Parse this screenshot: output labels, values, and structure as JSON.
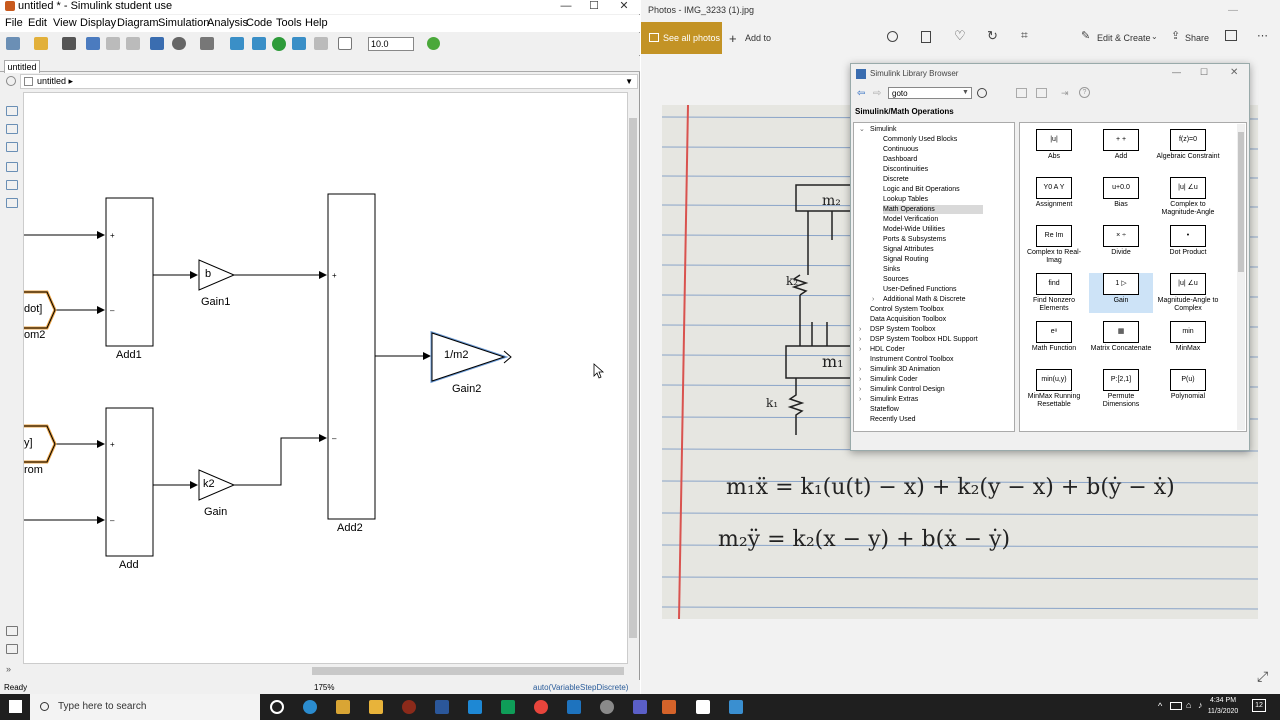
{
  "simulink": {
    "title": "untitled * - Simulink student use",
    "menu": [
      "File",
      "Edit",
      "View",
      "Display",
      "Diagram",
      "Simulation",
      "Analysis",
      "Code",
      "Tools",
      "Help"
    ],
    "sim_time": "10.0",
    "tab": "untitled",
    "address": "untitled",
    "status_left": "Ready",
    "status_zoom": "175%",
    "status_solver": "auto(VariableStepDiscrete)",
    "blocks": {
      "add1_label": "Add1",
      "add2_label": "Add2",
      "add_label": "Add",
      "gain1_value": "b",
      "gain1_label": "Gain1",
      "gain_value": "k2",
      "gain_label": "Gain",
      "gain2_value": "1/m2",
      "gain2_label": "Gain2",
      "from_upper_text": "dot]",
      "from_upper_label": "om2",
      "from_lower_text": "y]",
      "from_lower_label": "rom"
    }
  },
  "photos": {
    "title": "Photos - IMG_3233 (1).jpg",
    "see_all": "See all photos",
    "add_to": "Add to",
    "edit_create": "Edit & Create",
    "share": "Share",
    "equation1": "m₁ẍ = k₁(u(t) − x) + k₂(y − x) + b(ẏ − ẋ)",
    "equation2": "m₂ÿ = k₂(x − y) + b(ẋ − ẏ)"
  },
  "library": {
    "title": "Simulink Library Browser",
    "search": "goto",
    "path": "Simulink/Math Operations",
    "tree": [
      {
        "label": "Simulink",
        "level": 0,
        "expanded": true
      },
      {
        "label": "Commonly Used Blocks",
        "level": 2
      },
      {
        "label": "Continuous",
        "level": 2
      },
      {
        "label": "Dashboard",
        "level": 2
      },
      {
        "label": "Discontinuities",
        "level": 2
      },
      {
        "label": "Discrete",
        "level": 2
      },
      {
        "label": "Logic and Bit Operations",
        "level": 2
      },
      {
        "label": "Lookup Tables",
        "level": 2
      },
      {
        "label": "Math Operations",
        "level": 2,
        "selected": true
      },
      {
        "label": "Model Verification",
        "level": 2
      },
      {
        "label": "Model-Wide Utilities",
        "level": 2
      },
      {
        "label": "Ports & Subsystems",
        "level": 2
      },
      {
        "label": "Signal Attributes",
        "level": 2
      },
      {
        "label": "Signal Routing",
        "level": 2
      },
      {
        "label": "Sinks",
        "level": 2
      },
      {
        "label": "Sources",
        "level": 2
      },
      {
        "label": "User-Defined Functions",
        "level": 2
      },
      {
        "label": "Additional Math & Discrete",
        "level": 1
      },
      {
        "label": "Control System Toolbox",
        "level": 0
      },
      {
        "label": "Data Acquisition Toolbox",
        "level": 0
      },
      {
        "label": "DSP System Toolbox",
        "level": 0
      },
      {
        "label": "DSP System Toolbox HDL Support",
        "level": 0
      },
      {
        "label": "HDL Coder",
        "level": 0
      },
      {
        "label": "Instrument Control Toolbox",
        "level": 0
      },
      {
        "label": "Simulink 3D Animation",
        "level": 0
      },
      {
        "label": "Simulink Coder",
        "level": 0
      },
      {
        "label": "Simulink Control Design",
        "level": 0
      },
      {
        "label": "Simulink Extras",
        "level": 0
      },
      {
        "label": "Stateflow",
        "level": 0
      },
      {
        "label": "Recently Used",
        "level": 0
      }
    ],
    "blocks": [
      {
        "label": "Abs",
        "icon": "|u|"
      },
      {
        "label": "Add",
        "icon": "+ +"
      },
      {
        "label": "Algebraic Constraint",
        "icon": "f(z)=0"
      },
      {
        "label": "Assignment",
        "icon": "Y0 A Y"
      },
      {
        "label": "Bias",
        "icon": "u+0.0"
      },
      {
        "label": "Complex to Magnitude-Angle",
        "icon": "|u| ∠u"
      },
      {
        "label": "Complex to Real-Imag",
        "icon": "Re Im"
      },
      {
        "label": "Divide",
        "icon": "× ÷"
      },
      {
        "label": "Dot Product",
        "icon": "•"
      },
      {
        "label": "Find Nonzero Elements",
        "icon": "find"
      },
      {
        "label": "Gain",
        "icon": "1 ▷",
        "selected": true
      },
      {
        "label": "Magnitude-Angle to Complex",
        "icon": "|u| ∠u"
      },
      {
        "label": "Math Function",
        "icon": "eᵘ"
      },
      {
        "label": "Matrix Concatenate",
        "icon": "▦"
      },
      {
        "label": "MinMax",
        "icon": "min"
      },
      {
        "label": "MinMax Running Resettable",
        "icon": "min(u,y)"
      },
      {
        "label": "Permute Dimensions",
        "icon": "P:[2,1]"
      },
      {
        "label": "Polynomial",
        "icon": "P(u)"
      }
    ]
  },
  "taskbar": {
    "search_placeholder": "Type here to search",
    "time": "4:34 PM",
    "date": "11/3/2020",
    "notif_count": "12"
  }
}
